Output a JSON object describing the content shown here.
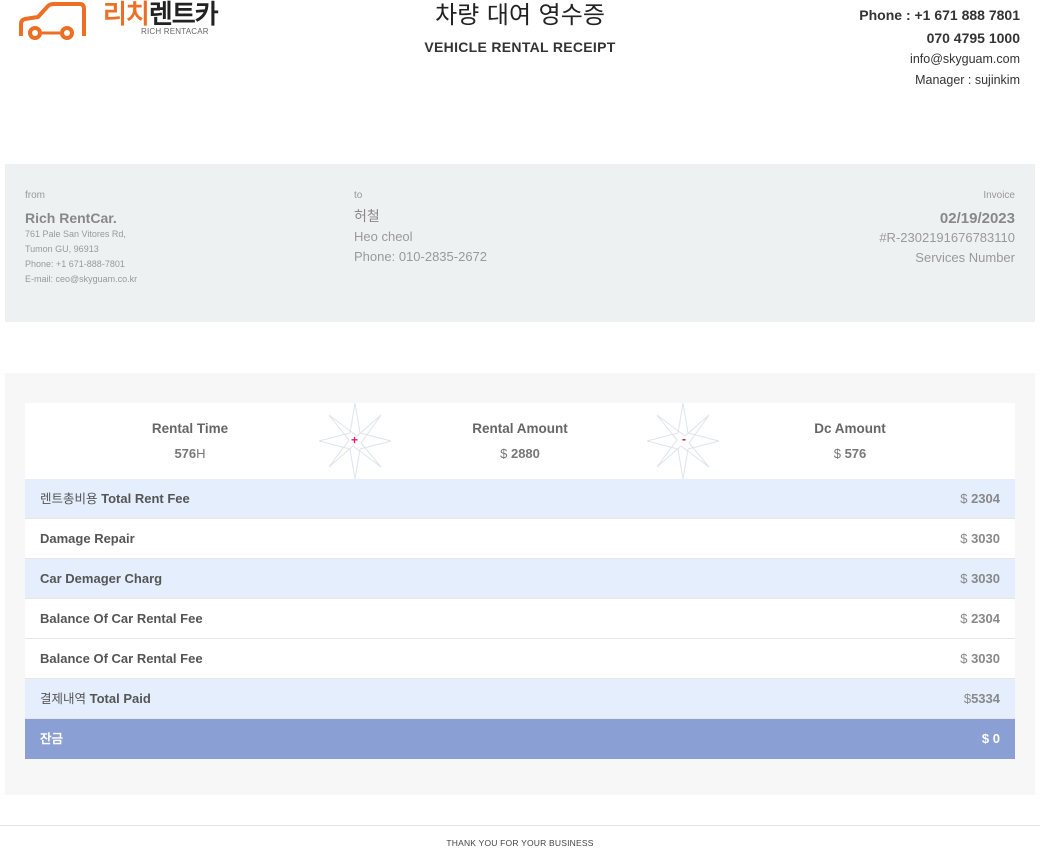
{
  "header": {
    "logo_text_colored": "리치",
    "logo_text_dark": "렌트카",
    "logo_sub": "RICH RENTACAR",
    "title_ko": "차량 대여 영수증",
    "title_en": "VEHICLE RENTAL RECEIPT",
    "phone1": "Phone : +1 671 888 7801",
    "phone2": "070 4795 1000",
    "email": "info@skyguam.com",
    "manager": "Manager : sujinkim"
  },
  "from": {
    "label": "from",
    "name": "Rich RentCar.",
    "address1": "761 Pale San Vitores Rd,",
    "address2": "Tumon GU, 96913",
    "phone": "Phone: +1 671-888-7801",
    "email": "E-mail: ceo@skyguam.co.kr"
  },
  "to": {
    "label": "to",
    "name_ko": "허철",
    "name_en": "Heo cheol",
    "phone": "Phone: 010-2835-2672"
  },
  "invoice": {
    "label": "Invoice",
    "date": "02/19/2023",
    "number": "#R-2302191676783110",
    "services": "Services Number"
  },
  "summary": {
    "rental_time_label": "Rental Time",
    "rental_time_value": "576",
    "rental_time_unit": "H",
    "rental_amount_label": "Rental Amount",
    "rental_amount_currency": "$",
    "rental_amount_value": "2880",
    "dc_amount_label": "Dc Amount",
    "dc_amount_currency": "$",
    "dc_amount_value": "576",
    "plus_sign": "+",
    "minus_sign": "-"
  },
  "rows": [
    {
      "label_ko": "렌트총비용",
      "label": "Total Rent Fee",
      "currency": "$",
      "value": "2304"
    },
    {
      "label_ko": "",
      "label": "Damage Repair",
      "currency": "$",
      "value": "3030"
    },
    {
      "label_ko": "",
      "label": "Car Demager Charg",
      "currency": "$",
      "value": "3030"
    },
    {
      "label_ko": "",
      "label": "Balance Of Car Rental Fee",
      "currency": "$",
      "value": "2304"
    },
    {
      "label_ko": "",
      "label": "Balance Of Car Rental Fee",
      "currency": "$",
      "value": "3030"
    },
    {
      "label_ko": "결제내역",
      "label": "Total Paid",
      "currency": "$",
      "value": "5334"
    },
    {
      "label_ko": "잔금",
      "label": "",
      "currency": "$",
      "value": "0"
    }
  ],
  "footer": "THANK YOU FOR YOUR BUSINESS",
  "colors": {
    "logo_orange": "#ec6f25",
    "row_blue": "#e4eefc",
    "balance_row": "#8aa0d4",
    "plus": "#e8186d",
    "minus": "#c8102e"
  }
}
